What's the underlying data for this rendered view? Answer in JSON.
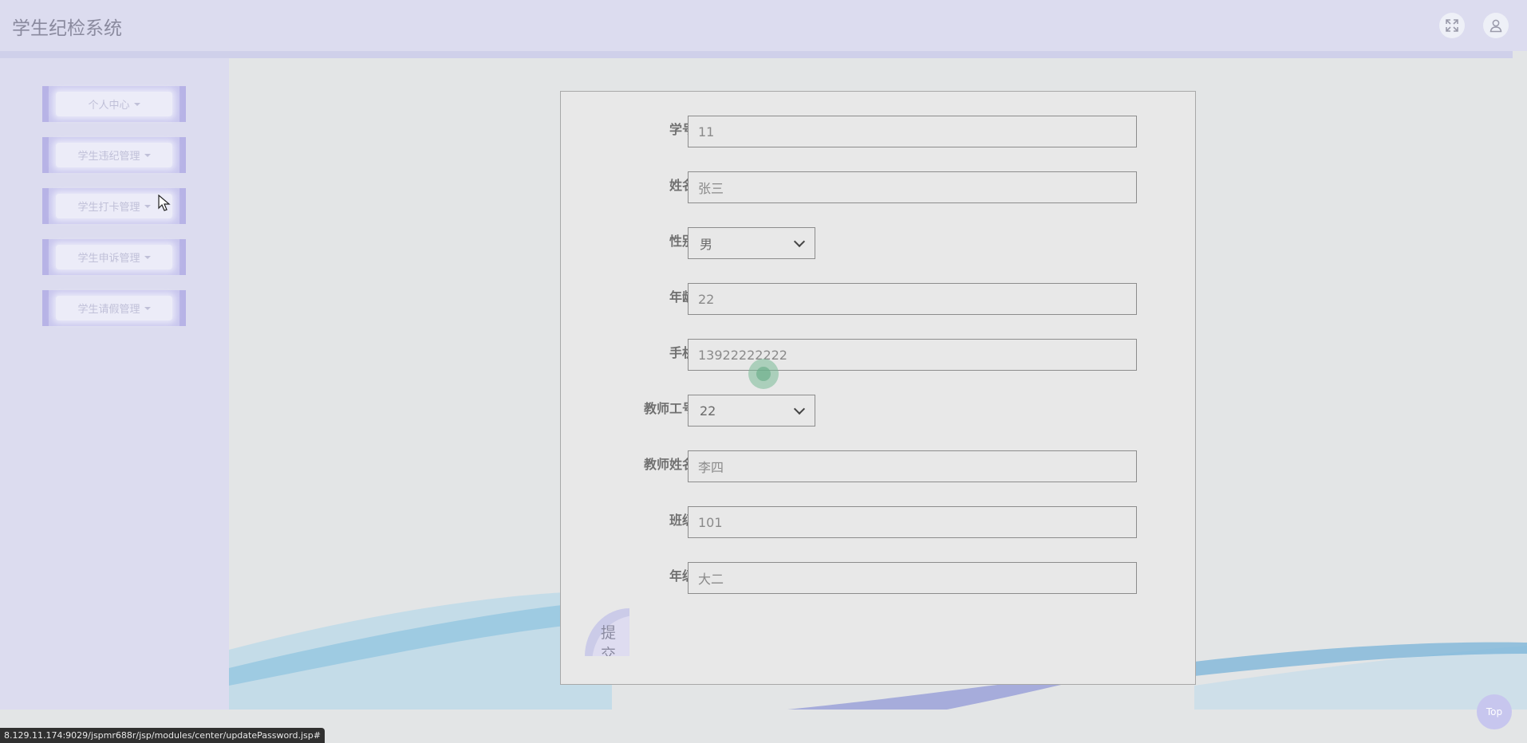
{
  "header": {
    "title": "学生纪检系统",
    "fullscreen_icon": "expand-icon",
    "user_icon": "user-icon"
  },
  "sidebar": {
    "items": [
      {
        "label": "个人中心"
      },
      {
        "label": "学生违纪管理"
      },
      {
        "label": "学生打卡管理"
      },
      {
        "label": "学生申诉管理"
      },
      {
        "label": "学生请假管理"
      }
    ]
  },
  "form": {
    "fields": [
      {
        "label": "学号",
        "value": "11",
        "type": "text"
      },
      {
        "label": "姓名",
        "value": "张三",
        "type": "text"
      },
      {
        "label": "性别",
        "value": "男",
        "type": "select"
      },
      {
        "label": "年龄",
        "value": "22",
        "type": "text"
      },
      {
        "label": "手机",
        "value": "13922222222",
        "type": "text"
      },
      {
        "label": "教师工号",
        "value": "22",
        "type": "select"
      },
      {
        "label": "教师姓名",
        "value": "李四",
        "type": "text"
      },
      {
        "label": "班级",
        "value": "101",
        "type": "text"
      },
      {
        "label": "年级",
        "value": "大二",
        "type": "text"
      }
    ],
    "submit_label": "提交"
  },
  "back_to_top": "Top",
  "status_url": "8.129.11.174:9029/jspmr688r/jsp/modules/center/updatePassword.jsp#"
}
